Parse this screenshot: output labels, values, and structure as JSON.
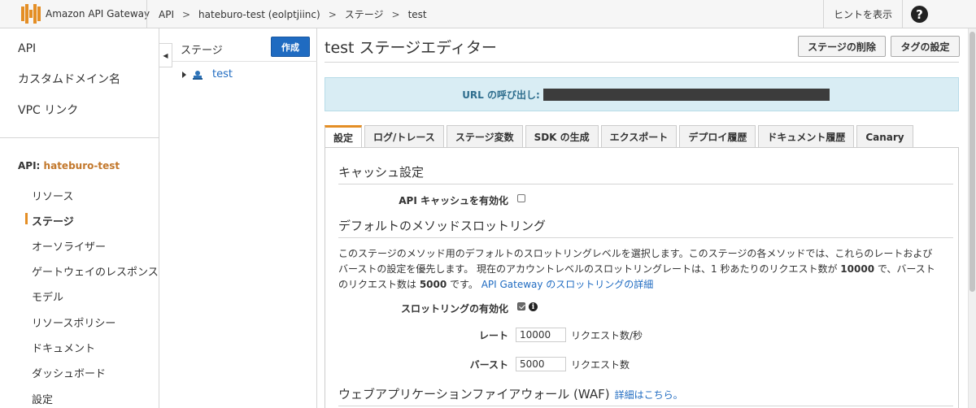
{
  "topbar": {
    "brand": "Amazon API Gateway",
    "breadcrumbs": [
      "API",
      "hateburo-test (eolptjiinc)",
      "ステージ",
      "test"
    ],
    "breadcrumb_separator": ">",
    "hint_label": "ヒントを表示",
    "help_label": "?"
  },
  "leftnav": {
    "top_items": [
      "API",
      "カスタムドメイン名",
      "VPC リンク"
    ],
    "api_prefix": "API:",
    "api_name": "hateburo-test",
    "sub_items": [
      "リソース",
      "ステージ",
      "オーソライザー",
      "ゲートウェイのレスポンス",
      "モデル",
      "リソースポリシー",
      "ドキュメント",
      "ダッシュボード",
      "設定"
    ],
    "active_item": "ステージ"
  },
  "stages_panel": {
    "title": "ステージ",
    "create_label": "作成",
    "items": [
      {
        "label": "test"
      }
    ]
  },
  "editor": {
    "title": "test ステージエディター",
    "delete_label": "ステージの削除",
    "tags_label": "タグの設定",
    "url_label": "URL の呼び出し:",
    "tabs": [
      "設定",
      "ログ/トレース",
      "ステージ変数",
      "SDK の生成",
      "エクスポート",
      "デプロイ履歴",
      "ドキュメント履歴",
      "Canary"
    ],
    "active_tab": "設定",
    "cache": {
      "heading": "キャッシュ設定",
      "enable_label": "API キャッシュを有効化",
      "enabled": false
    },
    "throttling": {
      "heading": "デフォルトのメソッドスロットリング",
      "desc_part1": "このステージのメソッド用のデフォルトのスロットリングレベルを選択します。このステージの各メソッドでは、これらのレートおよびバーストの設定を優先します。 現在のアカウントレベルのスロットリングレートは、1 秒あたりのリクエスト数が ",
      "account_rate": "10000",
      "desc_part2": " で、バーストのリクエスト数は ",
      "account_burst": "5000",
      "desc_part3": " です。",
      "details_link": "API Gateway のスロットリングの詳細",
      "enable_label": "スロットリングの有効化",
      "enabled": true,
      "rate_label": "レート",
      "rate_value": "10000",
      "rate_unit": "リクエスト数/秒",
      "burst_label": "バースト",
      "burst_value": "5000",
      "burst_unit": "リクエスト数"
    },
    "waf": {
      "heading": "ウェブアプリケーションファイアウォール (WAF)",
      "link": "詳細はこちら。"
    }
  },
  "colors": {
    "accent": "#e48e25",
    "primary_button": "#1f6bc1",
    "link": "#1f6bc1",
    "info_bg": "#d9edf4"
  }
}
